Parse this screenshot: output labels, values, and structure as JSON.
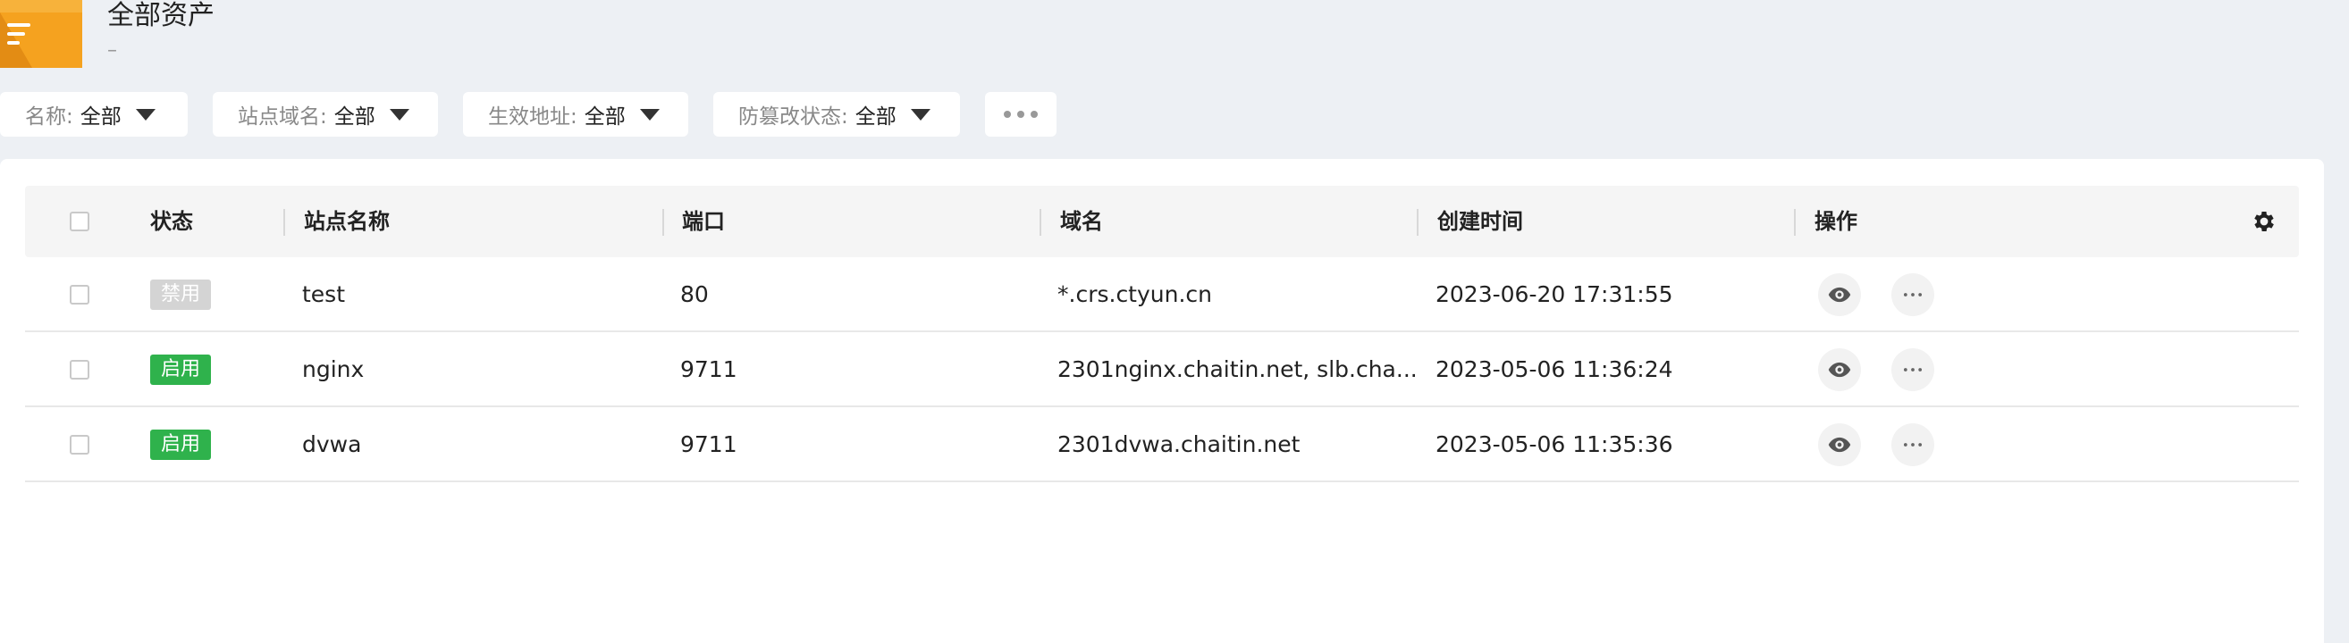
{
  "header": {
    "title": "全部资产",
    "subtitle": "–"
  },
  "filters": [
    {
      "label": "名称:",
      "value": "全部"
    },
    {
      "label": "站点域名:",
      "value": "全部"
    },
    {
      "label": "生效地址:",
      "value": "全部"
    },
    {
      "label": "防篡改状态:",
      "value": "全部"
    }
  ],
  "table": {
    "columns": {
      "status": "状态",
      "site_name": "站点名称",
      "port": "端口",
      "domain": "域名",
      "created": "创建时间",
      "actions": "操作"
    },
    "rows": [
      {
        "status": "禁用",
        "status_type": "disabled",
        "name": "test",
        "port": "80",
        "domain": "*.crs.ctyun.cn",
        "created": "2023-06-20 17:31:55"
      },
      {
        "status": "启用",
        "status_type": "enabled",
        "name": "nginx",
        "port": "9711",
        "domain": "2301nginx.chaitin.net, slb.cha...",
        "created": "2023-05-06 11:36:24"
      },
      {
        "status": "启用",
        "status_type": "enabled",
        "name": "dvwa",
        "port": "9711",
        "domain": "2301dvwa.chaitin.net",
        "created": "2023-05-06 11:35:36"
      }
    ]
  },
  "colors": {
    "enabled": "#2fb24c",
    "disabled": "#d4d4d4",
    "folder": "#f5a623"
  },
  "icons": [
    "folder-icon",
    "caret-down-icon",
    "more-dots-icon",
    "gear-icon",
    "eye-icon",
    "ellipsis-icon"
  ]
}
